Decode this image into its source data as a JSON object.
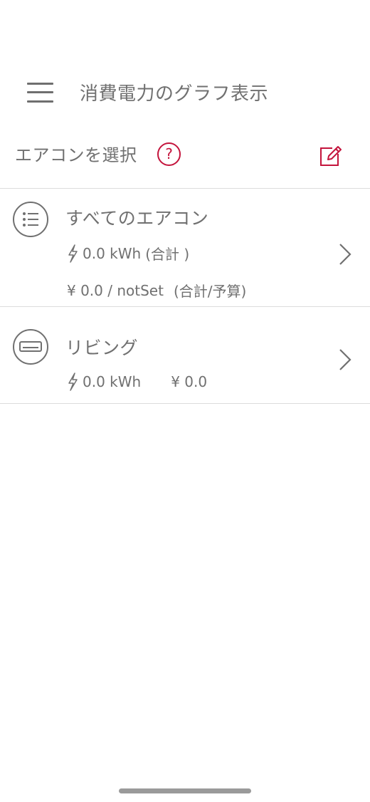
{
  "header": {
    "title": "消費電力のグラフ表示"
  },
  "select_section": {
    "label": "エアコンを選択",
    "help_symbol": "?"
  },
  "items": [
    {
      "name": "すべてのエアコン",
      "icon": "list-icon",
      "energy": "0.0 kWh",
      "energy_suffix": "(合計 )",
      "cost": "¥ 0.0 / notSet",
      "cost_suffix": "(合計/予算)"
    },
    {
      "name": "リビング",
      "icon": "air-conditioner-icon",
      "energy": "0.0 kWh",
      "cost": "¥ 0.0"
    }
  ],
  "colors": {
    "accent": "#c4143c",
    "text": "#707070",
    "divider": "#dcdcdc"
  }
}
